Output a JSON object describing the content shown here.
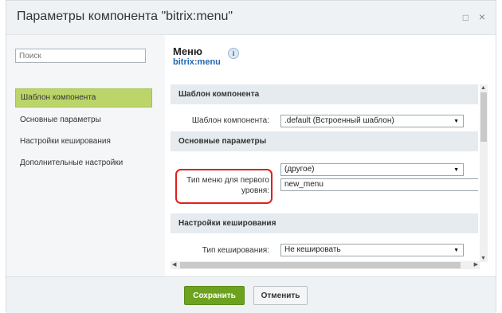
{
  "dialog": {
    "title": "Параметры компонента \"bitrix:menu\"",
    "maximize_icon": "square-icon",
    "close_icon": "×",
    "maximize_glyph": "□"
  },
  "sidebar": {
    "search_placeholder": "Поиск",
    "items": [
      {
        "label": "Шаблон компонента",
        "active": true
      },
      {
        "label": "Основные параметры",
        "active": false
      },
      {
        "label": "Настройки кеширования",
        "active": false
      },
      {
        "label": "Дополнительные настройки",
        "active": false
      }
    ]
  },
  "component": {
    "name": "Меню",
    "code": "bitrix:menu",
    "info_glyph": "i"
  },
  "sections": {
    "template": {
      "title": "Шаблон компонента",
      "template_label": "Шаблон компонента:",
      "template_value": ".default (Встроенный шаблон)"
    },
    "basic": {
      "title": "Основные параметры",
      "menu_type_label_line1": "Тип меню для первого",
      "menu_type_label_line2": "уровня:",
      "menu_type_value": "(другое)",
      "menu_type_custom": "new_menu"
    },
    "cache": {
      "title": "Настройки кеширования",
      "cache_type_label": "Тип кеширования:",
      "cache_type_value": "Не кешировать"
    }
  },
  "footer": {
    "save_label": "Сохранить",
    "cancel_label": "Отменить"
  }
}
